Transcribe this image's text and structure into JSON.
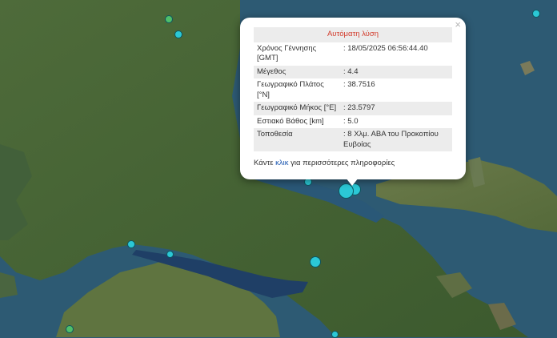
{
  "popup": {
    "title": "Αυτόματη λύση",
    "close_label": "×",
    "rows": [
      {
        "label": "Χρόνος Γέννησης [GMT]",
        "value": ": 18/05/2025 06:56:44.40"
      },
      {
        "label": "Μέγεθος",
        "value": ": 4.4"
      },
      {
        "label": "Γεωγραφικό Πλάτος [°N]",
        "value": ": 38.7516"
      },
      {
        "label": "Γεωγραφικό Μήκος [°E]",
        "value": ": 23.5797"
      },
      {
        "label": "Εστιακό Βάθος [km]",
        "value": ": 5.0"
      },
      {
        "label": "Τοποθεσία",
        "value": ": 8 Χλμ. ΑΒΑ του Προκοπίου Ευβοίας"
      }
    ],
    "info_prefix": "Κάντε ",
    "info_link": "κλικ",
    "info_suffix": " για περισσότερες πληροφορίες"
  },
  "colors": {
    "quake_marker": "#2bc8d6",
    "quake_marker_green": "#4fbf6a",
    "sea": "#2d5a73",
    "title_red": "#d23a2a",
    "link_blue": "#1a56b0"
  }
}
